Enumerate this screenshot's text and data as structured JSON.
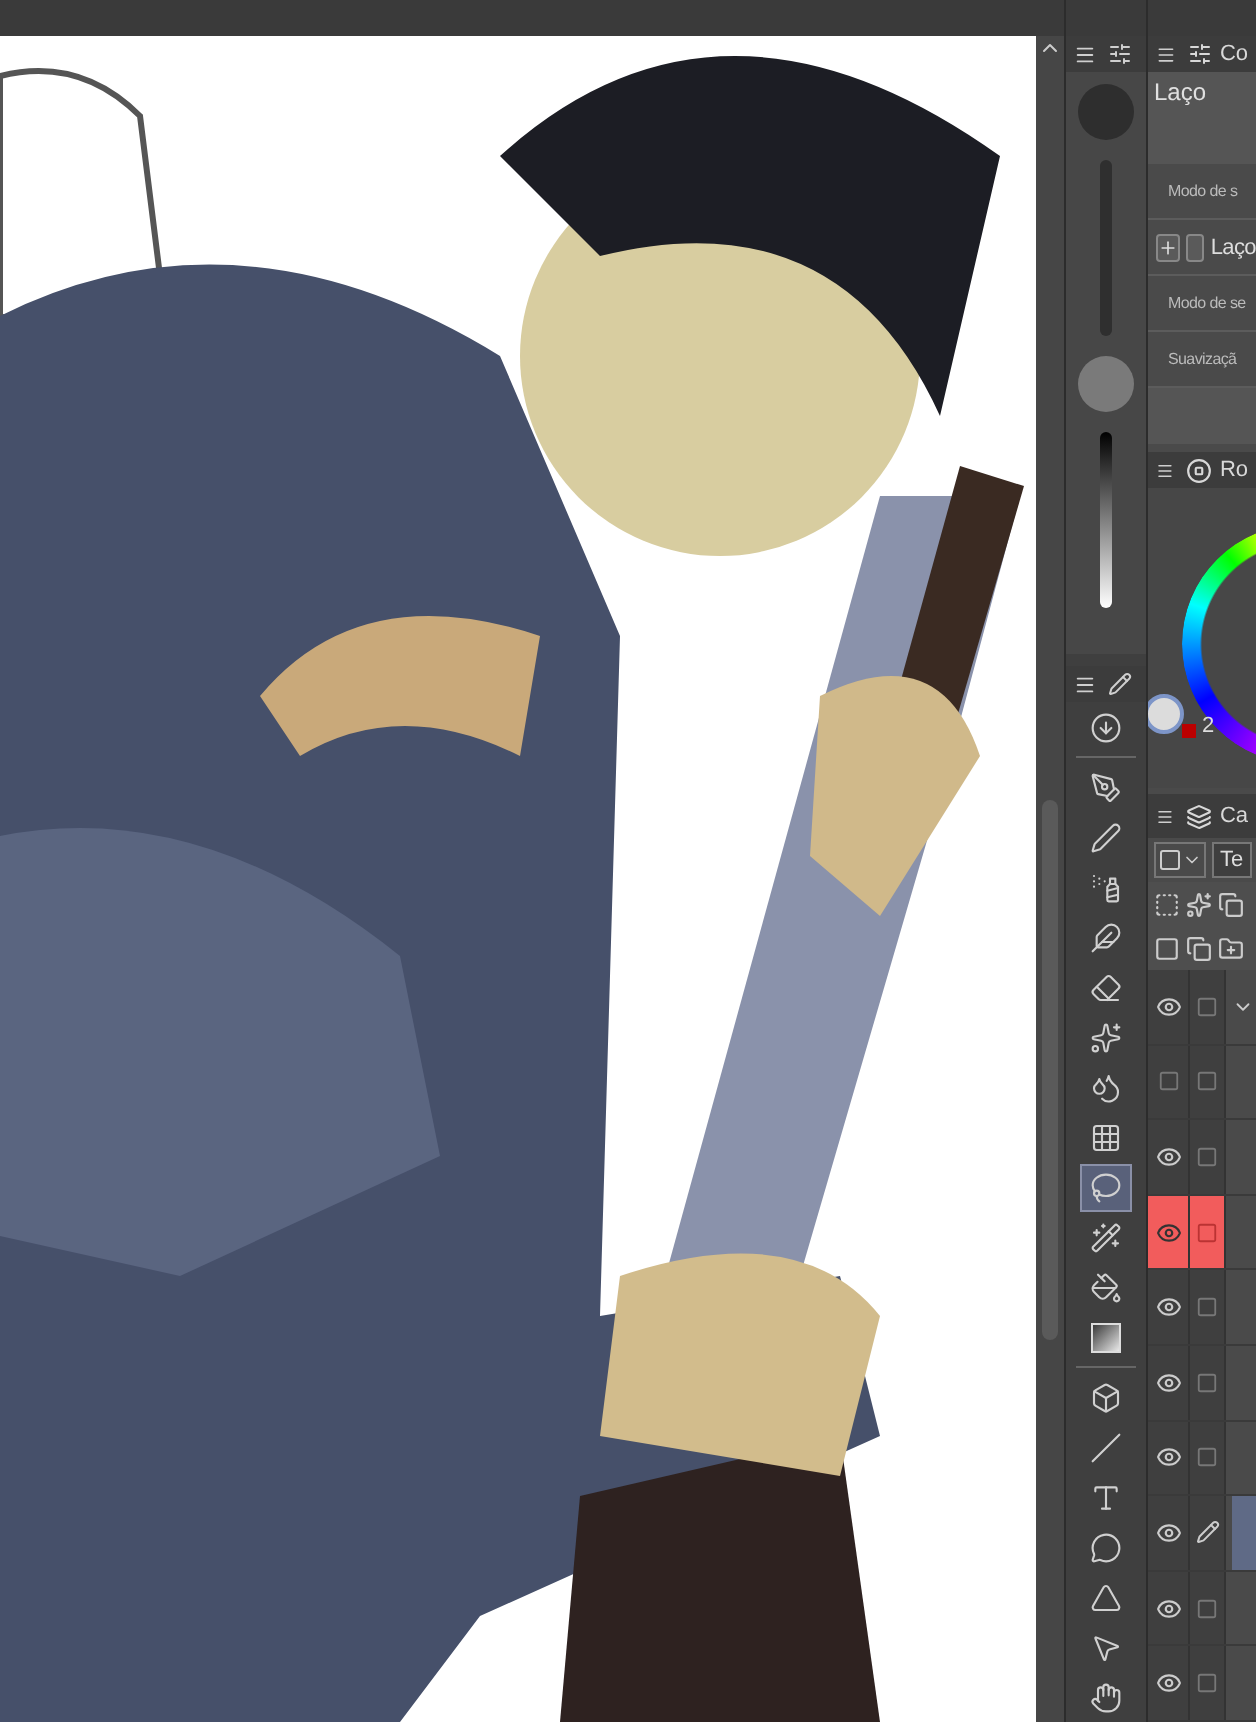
{
  "tool_property": {
    "tab": "Co",
    "title": "Laço",
    "rows": [
      {
        "kind": "label",
        "text": "Modo de s"
      },
      {
        "kind": "toggle",
        "text": "Laço",
        "expanded": false,
        "checked": false
      },
      {
        "kind": "label",
        "text": "Modo de se"
      },
      {
        "kind": "label",
        "text": "Suavizaçã"
      }
    ]
  },
  "color_wheel": {
    "tab": "Ro",
    "value": "2"
  },
  "tools": [
    {
      "kind": "download",
      "selected": false
    },
    {
      "kind": "pen_nib",
      "selected": false
    },
    {
      "kind": "pen",
      "selected": false
    },
    {
      "kind": "airbrush",
      "selected": false
    },
    {
      "kind": "brush",
      "selected": false
    },
    {
      "kind": "eraser",
      "selected": false
    },
    {
      "kind": "sparkle",
      "selected": false
    },
    {
      "kind": "blend",
      "selected": false
    },
    {
      "kind": "grid",
      "selected": false
    },
    {
      "kind": "lasso",
      "selected": true
    },
    {
      "kind": "wand",
      "selected": false
    },
    {
      "kind": "fill",
      "selected": false
    },
    {
      "kind": "gradient",
      "selected": false
    },
    {
      "kind": "box",
      "selected": false
    },
    {
      "kind": "line",
      "selected": false
    },
    {
      "kind": "text",
      "selected": false
    },
    {
      "kind": "balloon",
      "selected": false
    },
    {
      "kind": "frame",
      "selected": false
    },
    {
      "kind": "pointer",
      "selected": false
    },
    {
      "kind": "hand",
      "selected": false
    }
  ],
  "layers": {
    "tab": "Ca",
    "blend_mode": "Te",
    "rows": [
      {
        "kind": "folder",
        "visible": true,
        "expanded": true,
        "selected": false
      },
      {
        "kind": "layer",
        "visible": false,
        "selected": false
      },
      {
        "kind": "layer",
        "visible": true,
        "selected": false
      },
      {
        "kind": "layer",
        "visible": true,
        "selected": true
      },
      {
        "kind": "layer",
        "visible": true,
        "selected": false
      },
      {
        "kind": "layer",
        "visible": true,
        "selected": false
      },
      {
        "kind": "layer",
        "visible": true,
        "selected": false
      },
      {
        "kind": "editing",
        "visible": true,
        "selected": false
      },
      {
        "kind": "layer",
        "visible": true,
        "selected": false
      },
      {
        "kind": "layer",
        "visible": true,
        "selected": false
      }
    ]
  }
}
